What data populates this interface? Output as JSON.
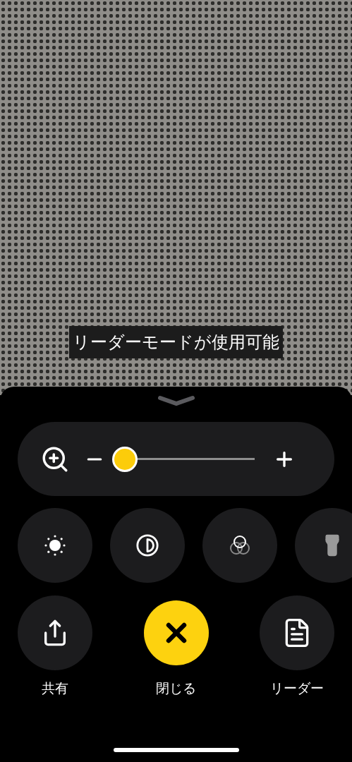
{
  "camera_banner": {
    "text": "リーダーモードが使用可能"
  },
  "zoom": {
    "level": 0.07
  },
  "tools": [
    {
      "kind": "brightness"
    },
    {
      "kind": "contrast"
    },
    {
      "kind": "filters"
    },
    {
      "kind": "flashlight"
    }
  ],
  "actions": [
    {
      "kind": "share",
      "label": "共有"
    },
    {
      "kind": "close",
      "label": "閉じる"
    },
    {
      "kind": "reader",
      "label": "リーダー"
    }
  ]
}
